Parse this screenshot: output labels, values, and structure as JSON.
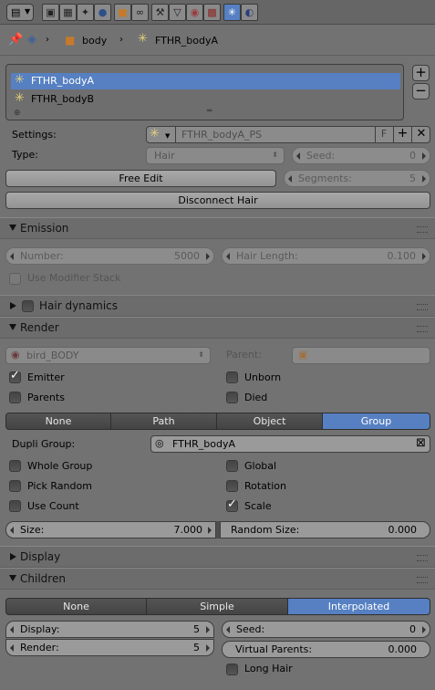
{
  "header": {
    "editor_menu_icon": "editor-type-icon",
    "tabs": [
      {
        "icon": "render-icon"
      },
      {
        "icon": "render-layers-icon"
      },
      {
        "icon": "scene-icon"
      },
      {
        "icon": "world-icon"
      },
      {
        "icon": "object-icon"
      },
      {
        "icon": "constraints-icon"
      },
      {
        "icon": "modifiers-icon"
      },
      {
        "icon": "data-icon"
      },
      {
        "icon": "material-icon"
      },
      {
        "icon": "texture-icon"
      },
      {
        "icon": "particles-icon",
        "selected": true
      },
      {
        "icon": "physics-icon"
      }
    ]
  },
  "breadcrumb": {
    "object": "body",
    "particle_system": "FTHR_bodyA"
  },
  "list": {
    "items": [
      "FTHR_bodyA",
      "FTHR_bodyB"
    ],
    "selected": 0
  },
  "settings": {
    "settings_label": "Settings:",
    "settings_value": "FTHR_bodyA_PS",
    "fake_user": "F",
    "type_label": "Type:",
    "type_value": "Hair",
    "seed_label": "Seed:",
    "seed_value": "0",
    "free_edit": "Free Edit",
    "segments_label": "Segments:",
    "segments_value": "5",
    "disconnect_hair": "Disconnect Hair"
  },
  "emission": {
    "title": "Emission",
    "number_label": "Number:",
    "number_value": "5000",
    "hair_length_label": "Hair Length:",
    "hair_length_value": "0.100",
    "use_modifier_stack": "Use Modifier Stack"
  },
  "hair_dynamics": {
    "title": "Hair dynamics"
  },
  "render": {
    "title": "Render",
    "material": "bird_BODY",
    "parent_label": "Parent:",
    "emitter": "Emitter",
    "emitter_checked": true,
    "unborn": "Unborn",
    "parents": "Parents",
    "died": "Died",
    "modes": [
      "None",
      "Path",
      "Object",
      "Group"
    ],
    "active_mode": 3,
    "dupli_group_label": "Dupli Group:",
    "dupli_group_value": "FTHR_bodyA",
    "whole_group": "Whole Group",
    "global": "Global",
    "pick_random": "Pick Random",
    "rotation": "Rotation",
    "use_count": "Use Count",
    "scale": "Scale",
    "scale_checked": true,
    "size_label": "Size:",
    "size_value": "7.000",
    "random_size_label": "Random Size:",
    "random_size_value": "0.000"
  },
  "display": {
    "title": "Display"
  },
  "children": {
    "title": "Children",
    "modes": [
      "None",
      "Simple",
      "Interpolated"
    ],
    "active_mode": 2,
    "display_label": "Display:",
    "display_value": "5",
    "seed_label": "Seed:",
    "seed_value": "0",
    "render_label": "Render:",
    "render_value": "5",
    "virtual_parents_label": "Virtual Parents:",
    "virtual_parents_value": "0.000",
    "long_hair": "Long Hair"
  },
  "colors": {
    "accent": "#5680c2",
    "panel_bg": "#727272",
    "header_bg": "#666666"
  }
}
